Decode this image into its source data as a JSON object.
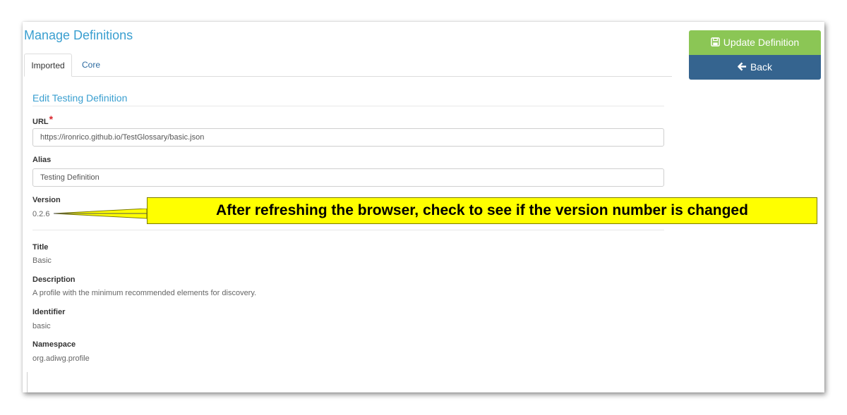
{
  "header": {
    "title": "Manage Definitions"
  },
  "tabs": [
    {
      "label": "Imported",
      "active": true
    },
    {
      "label": "Core",
      "active": false
    }
  ],
  "section": {
    "title": "Edit Testing Definition"
  },
  "fields": {
    "url": {
      "label": "URL",
      "required_mark": "*",
      "value": "https://ironrico.github.io/TestGlossary/basic.json"
    },
    "alias": {
      "label": "Alias",
      "value": "Testing Definition"
    },
    "version": {
      "label": "Version",
      "value": "0.2.6"
    },
    "title": {
      "label": "Title",
      "value": "Basic"
    },
    "description": {
      "label": "Description",
      "value": "A profile with the minimum recommended elements for discovery."
    },
    "identifier": {
      "label": "Identifier",
      "value": "basic"
    },
    "namespace": {
      "label": "Namespace",
      "value": "org.adiwg.profile"
    }
  },
  "buttons": {
    "update": {
      "label": "Update Definition",
      "icon": "save-icon"
    },
    "back": {
      "label": "Back",
      "icon": "arrow-left-icon"
    }
  },
  "annotation": {
    "text": "After refreshing the browser, check to see if the version number is changed"
  },
  "colors": {
    "accent": "#3a9fd0",
    "update_button": "#8bc655",
    "back_button": "#35648f",
    "callout": "#ffff00"
  }
}
